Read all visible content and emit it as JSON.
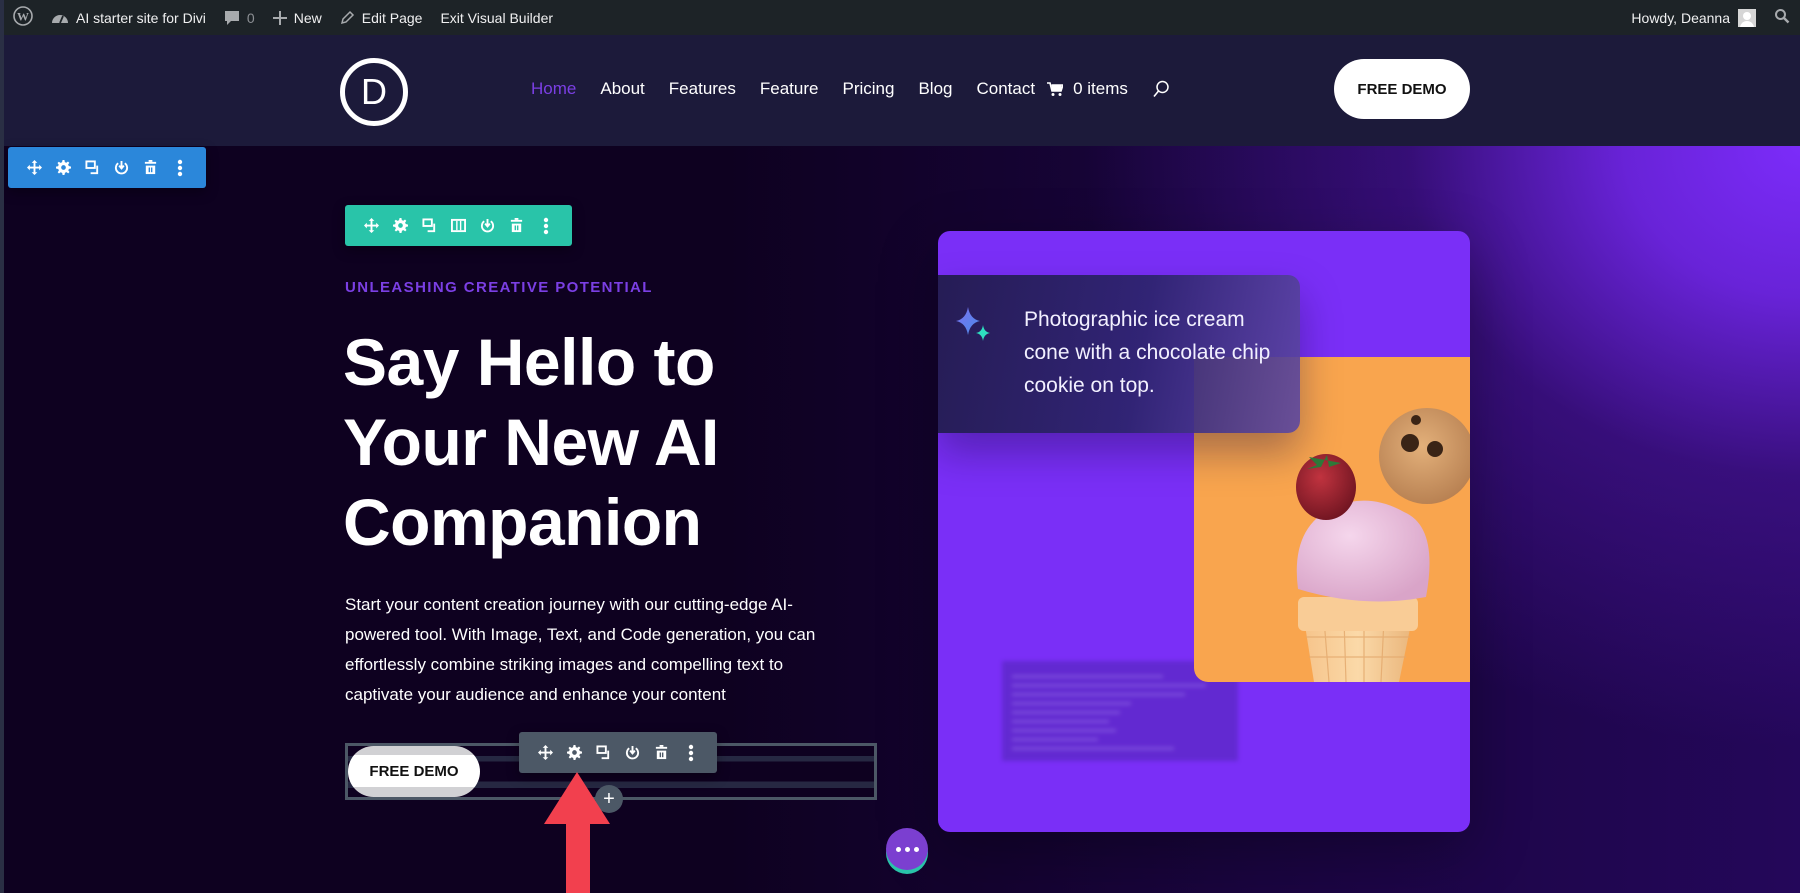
{
  "adminbar": {
    "wp_logo": "wordpress-logo-icon",
    "site_name": "AI starter site for Divi",
    "comments_count": "0",
    "new_label": "New",
    "edit_page_label": "Edit Page",
    "exit_builder_label": "Exit Visual Builder",
    "greeting": "Howdy, Deanna"
  },
  "header": {
    "logo_letter": "D",
    "nav": [
      {
        "label": "Home",
        "active": true
      },
      {
        "label": "About"
      },
      {
        "label": "Features"
      },
      {
        "label": "Feature"
      },
      {
        "label": "Pricing"
      },
      {
        "label": "Blog"
      },
      {
        "label": "Contact"
      }
    ],
    "cart_label": "0 items",
    "cta_label": "FREE DEMO"
  },
  "builder": {
    "section_toolbar": [
      "move",
      "settings",
      "duplicate",
      "disable",
      "delete",
      "more"
    ],
    "row_toolbar": [
      "move",
      "settings",
      "duplicate",
      "columns",
      "disable",
      "delete",
      "more"
    ],
    "module_toolbar": [
      "move",
      "settings",
      "duplicate",
      "disable",
      "delete",
      "more"
    ],
    "add_label": "+",
    "colors": {
      "section": "#2b87da",
      "row": "#29c4a9",
      "module": "#4c5866"
    }
  },
  "hero": {
    "eyebrow": "UNLEASHING CREATIVE POTENTIAL",
    "headline_lines": [
      "Say Hello to",
      "Your New AI",
      "Companion"
    ],
    "body": "Start your content creation journey with our cutting-edge AI-powered tool. With Image, Text, and Code generation, you can effortlessly combine striking images and compelling text to captivate your audience and enhance your content",
    "cta_label": "FREE DEMO",
    "accent_color": "#7b3fe4"
  },
  "card": {
    "prompt": "Photographic ice cream cone with a chocolate chip cookie on top.",
    "image_alt": "Ice cream cone with strawberry and chocolate chip cookie on orange background"
  }
}
